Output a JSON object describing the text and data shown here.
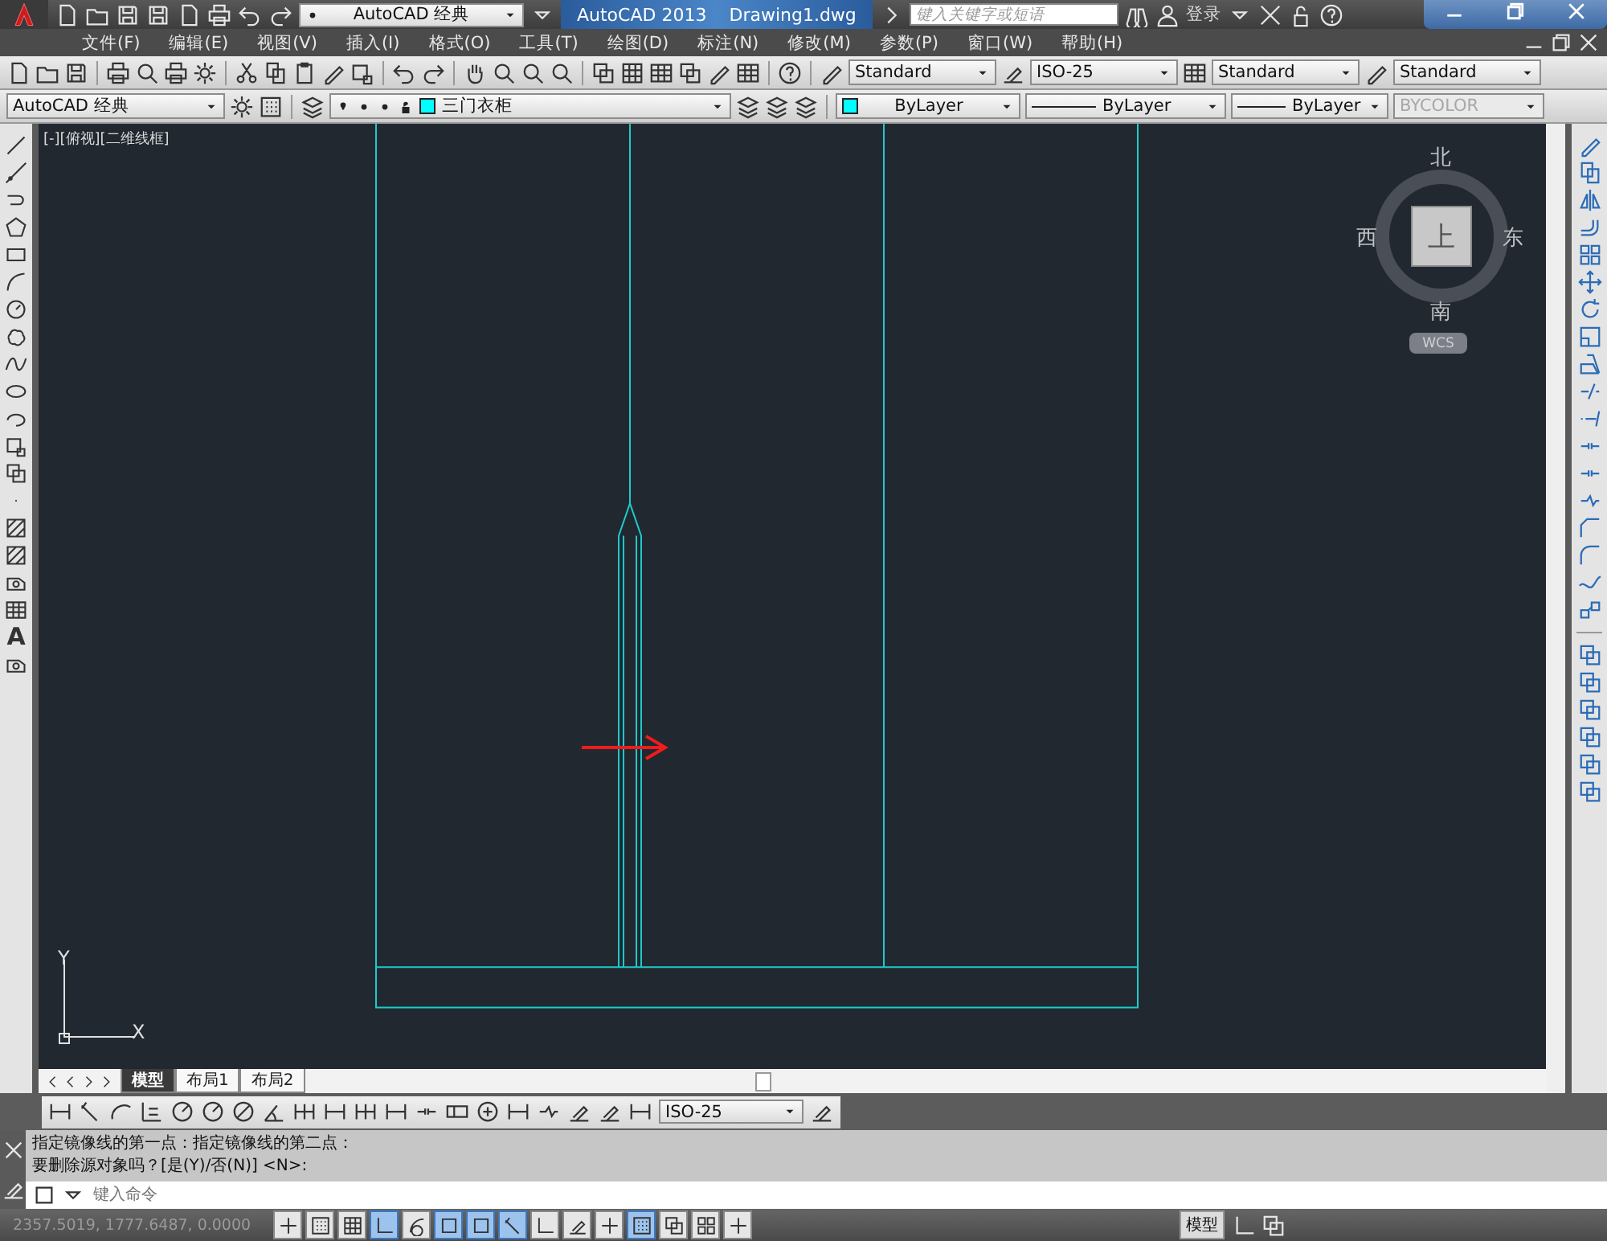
{
  "title_bar": {
    "workspace": "AutoCAD 经典",
    "app_name": "AutoCAD 2013",
    "file_name": "Drawing1.dwg",
    "search": {
      "placeholder": "键入关键字或短语"
    },
    "sign_in": "登录"
  },
  "menu": [
    "文件(F)",
    "编辑(E)",
    "视图(V)",
    "插入(I)",
    "格式(O)",
    "工具(T)",
    "绘图(D)",
    "标注(N)",
    "修改(M)",
    "参数(P)",
    "窗口(W)",
    "帮助(H)"
  ],
  "styles_toolbar": {
    "text_style": "Standard",
    "dimension_style": "ISO-25",
    "table_style": "Standard",
    "multileader_style": "Standard"
  },
  "workspace_toolbar": {
    "workspace": "AutoCAD 经典"
  },
  "layers_toolbar": {
    "layer": "三门衣柜"
  },
  "properties_toolbar": {
    "color_control": "ByLayer",
    "linetype": "ByLayer",
    "lineweight": "ByLayer",
    "plot_style": {
      "value": "BYCOLOR",
      "disabled": true
    }
  },
  "draw_toolbar": {
    "text_glyph": "A"
  },
  "viewport": {
    "label": "[-][俯视][二维线框]",
    "viewcube": {
      "north": "北",
      "west": "西",
      "east": "东",
      "south": "南",
      "face": "上",
      "ucs_menu": "WCS"
    },
    "ucs_icon": {
      "y_label": "Y",
      "x_label": "X"
    }
  },
  "layout_tabs": [
    {
      "label": "模型",
      "selected": true
    },
    {
      "label": "布局1",
      "selected": false
    },
    {
      "label": "布局2",
      "selected": false
    }
  ],
  "dimension_toolbar": {
    "dimension_style": "ISO-25"
  },
  "command_line": {
    "history": [
      "指定镜像线的第一点：指定镜像线的第二点：",
      "要删除源对象吗？[是(Y)/否(N)] <N>:"
    ],
    "placeholder": "键入命令"
  },
  "status_bar": {
    "coordinates": "2357.5019, 1777.6487, 0.0000",
    "toggles": [
      {
        "on": false
      },
      {
        "on": false
      },
      {
        "on": false
      },
      {
        "on": true
      },
      {
        "on": false
      },
      {
        "on": true
      },
      {
        "on": true
      },
      {
        "on": true
      },
      {
        "on": false
      },
      {
        "on": false
      },
      {
        "on": false
      },
      {
        "on": true
      },
      {
        "on": false
      },
      {
        "on": false
      },
      {
        "on": false
      }
    ],
    "space": "模型"
  }
}
